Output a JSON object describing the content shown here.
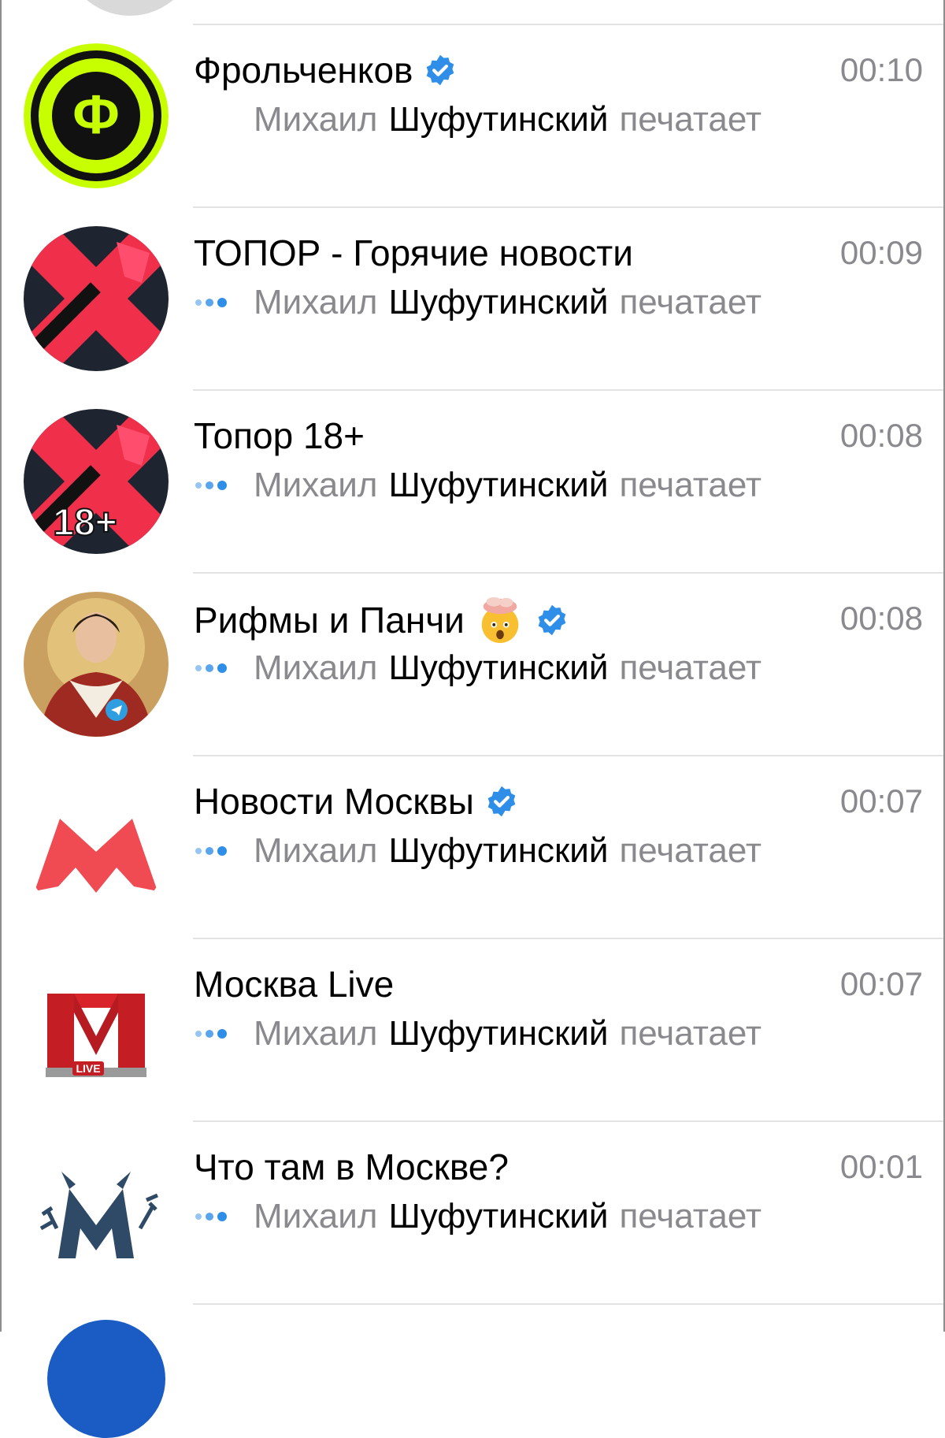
{
  "chats": [
    {
      "id": "frolchenkov",
      "title": "Фрольченков",
      "verified": true,
      "time": "00:10",
      "typing_user": "Михаил",
      "typing_name": "Шуфутинский",
      "typing_suffix": "печатает",
      "show_dots": false,
      "avatar_icon": "phi-logo-icon",
      "avatar_text": "Ф"
    },
    {
      "id": "topor",
      "title": "ТОПОР - Горячие новости",
      "verified": false,
      "time": "00:09",
      "typing_user": "Михаил",
      "typing_name": "Шуфутинский",
      "typing_suffix": "печатает",
      "show_dots": true,
      "avatar_icon": "axe-cross-icon"
    },
    {
      "id": "topor18",
      "title": "Топор 18+",
      "verified": false,
      "time": "00:08",
      "typing_user": "Михаил",
      "typing_name": "Шуфутинский",
      "typing_suffix": "печатает",
      "show_dots": true,
      "avatar_icon": "axe-cross-18-icon",
      "avatar_text": "18+"
    },
    {
      "id": "rifmy",
      "title": "Рифмы и Панчи",
      "verified": true,
      "time": "00:08",
      "typing_user": "Михаил",
      "typing_name": "Шуфутинский",
      "typing_suffix": "печатает",
      "show_dots": true,
      "avatar_icon": "icon-portrait-icon",
      "title_emoji": "exploding-head-icon"
    },
    {
      "id": "novosti-moskvy",
      "title": "Новости Москвы",
      "verified": true,
      "time": "00:07",
      "typing_user": "Михаил",
      "typing_name": "Шуфутинский",
      "typing_suffix": "печатает",
      "show_dots": true,
      "avatar_icon": "red-m-icon"
    },
    {
      "id": "moskva-live",
      "title": "Москва Live",
      "verified": false,
      "time": "00:07",
      "typing_user": "Михаил",
      "typing_name": "Шуфутинский",
      "typing_suffix": "печатает",
      "show_dots": true,
      "avatar_icon": "m-live-icon",
      "avatar_text": "LIVE"
    },
    {
      "id": "chto-tam",
      "title": "Что там в Москве?",
      "verified": false,
      "time": "00:01",
      "typing_user": "Михаил",
      "typing_name": "Шуфутинский",
      "typing_suffix": "печатает",
      "show_dots": true,
      "avatar_icon": "devil-m-icon"
    }
  ],
  "colors": {
    "verified": "#2f8ee8",
    "typing_dots": "#2f8ee8",
    "time": "#8a8a8e",
    "separator": "#e3e3e3"
  }
}
